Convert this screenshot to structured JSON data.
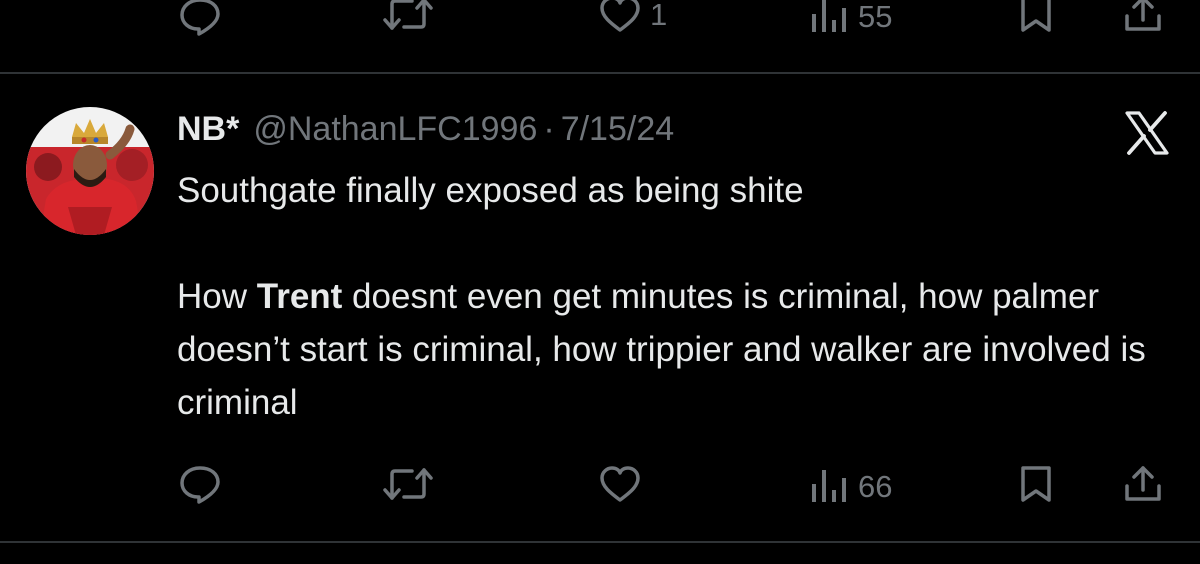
{
  "top_actions": {
    "reply_count": "",
    "retweet_count": "",
    "like_count": "1",
    "views_count": "55"
  },
  "tweet": {
    "display_name": "NB*",
    "handle": "@NathanLFC1996",
    "separator": "·",
    "date": "7/15/24",
    "text_line1": "Southgate finally exposed as being shite",
    "text_p2_prefix": "How ",
    "text_p2_bold": "Trent",
    "text_p2_rest": " doesnt even get minutes is criminal, how palmer doesn’t start is criminal, how trippier and walker are involved is criminal",
    "actions": {
      "reply_count": "",
      "retweet_count": "",
      "like_count": "",
      "views_count": "66"
    }
  },
  "colors": {
    "background": "#000000",
    "text_primary": "#e7e9ea",
    "text_secondary": "#71767b",
    "divider": "#2f3336"
  },
  "icons": [
    "reply-icon",
    "retweet-icon",
    "like-icon",
    "views-icon",
    "bookmark-icon",
    "share-icon",
    "x-logo-icon"
  ]
}
